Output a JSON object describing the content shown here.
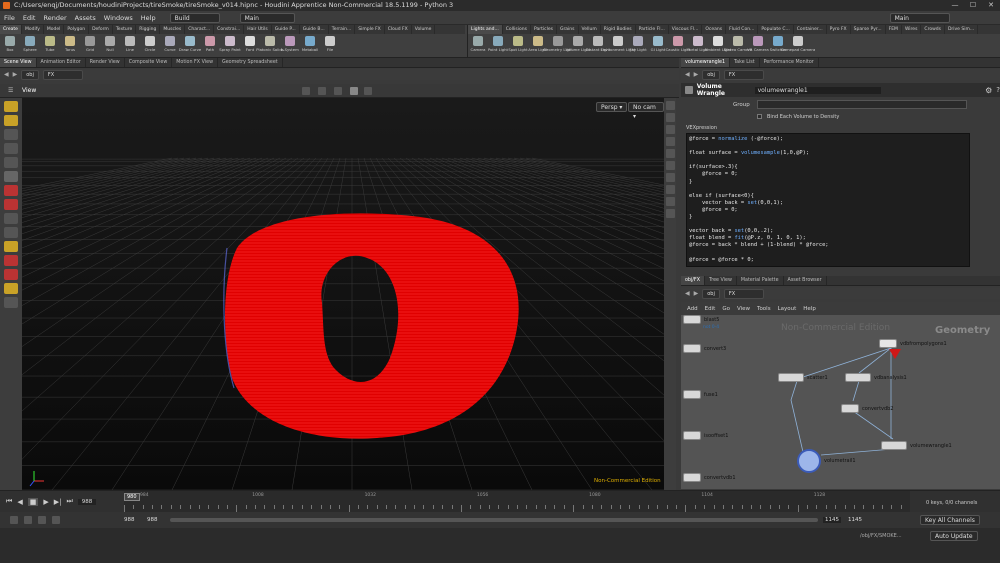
{
  "window": {
    "title": "C:/Users/enqj/Documents/houdiniProjects/tireSmoke/tireSmoke_v014.hipnc - Houdini Apprentice Non-Commercial 18.5.1199 - Python 3"
  },
  "menu": {
    "items": [
      "File",
      "Edit",
      "Render",
      "Assets",
      "Windows",
      "Help"
    ],
    "desktop_left": "Build",
    "desktop_mid": "Main",
    "desktop_right": "Main"
  },
  "shelf_left": {
    "tabs": [
      "Create",
      "Modify",
      "Model",
      "Polygon",
      "Deform",
      "Texture",
      "Rigging",
      "Muscles",
      "Charact...",
      "Constrai...",
      "Hair Utils",
      "Guide P...",
      "Guide B...",
      "Terrain...",
      "Simple FX",
      "Cloud FX",
      "Volume"
    ],
    "tools": [
      "Box",
      "Sphere",
      "Tube",
      "Torus",
      "Grid",
      "Null",
      "Line",
      "Circle",
      "Curve",
      "Draw Curve",
      "Path",
      "Spray Paint",
      "Font",
      "Platonic Solids",
      "L-System",
      "Metaball",
      "File"
    ]
  },
  "shelf_right": {
    "tabs": [
      "Lights and...",
      "Collisions",
      "Particles",
      "Grains",
      "Vellum",
      "Rigid Bodies",
      "Particle Fl...",
      "Viscous Fl...",
      "Oceans",
      "Fluid Con...",
      "Populate C...",
      "Container...",
      "Pyro FX",
      "Sparse Pyr...",
      "FEM",
      "Wires",
      "Crowds",
      "Drive Sim..."
    ],
    "tools": [
      "Camera",
      "Point Light",
      "Spot Light",
      "Area Light",
      "Geometry Light",
      "Volume Light",
      "Distant Light",
      "Environment Light",
      "Sky Light",
      "GI Light",
      "Caustic Light",
      "Portal Light",
      "Ambient Light",
      "Stereo Camera",
      "VR Camera",
      "Switcher",
      "Gamepad Camera"
    ]
  },
  "viewer_tabs": [
    "Scene View",
    "Animation Editor",
    "Render View",
    "Composite View",
    "Motion FX View",
    "Geometry Spreadsheet"
  ],
  "viewer": {
    "path_root": "obj",
    "path_node": "FX",
    "label": "View",
    "persp": "Persp",
    "cam": "No cam",
    "watermark": "Non-Commercial Edition"
  },
  "param_tabs": [
    "volumewrangle1",
    "Take List",
    "Performance Monitor"
  ],
  "params": {
    "path_root": "obj",
    "path_node": "FX",
    "node_type": "Volume Wrangle",
    "node_name": "volumewrangle1",
    "group_label": "Group",
    "bind_label": "Bind Each Volume to Density",
    "vex_label": "VEXpression",
    "code": [
      "@force = normalize (-@force);",
      "",
      "float surface = volumesample(1,0,@P);",
      "",
      "if(surface>.3){",
      "    @force = 0;",
      "}",
      "",
      "else if (surface<0){",
      "    vector back = set(0,0,1);",
      "    @force = 0;",
      "}",
      "",
      "vector back = set(0,0,.2);",
      "float blend = fit(@P.z, 0, 1, 0, 1);",
      "@force = back * blend + (1-blend) * @force;",
      "",
      "@force = @force * 0;"
    ]
  },
  "net_tabs": [
    "obj/FX",
    "Tree View",
    "Material Palette",
    "Asset Browser"
  ],
  "network": {
    "path_root": "obj",
    "path_node": "FX",
    "menu": [
      "Add",
      "Edit",
      "Go",
      "View",
      "Tools",
      "Layout",
      "Help"
    ],
    "watermark": "Non-Commercial Edition",
    "context": "Geometry",
    "nodes": {
      "blast": "blast5",
      "blast_sub": "not 0-4",
      "convert": "convert3",
      "fuse": "fuse1",
      "isooffset": "isooffset1",
      "convertvdb": "convertvdb1",
      "vdbfrompolygons": "vdbfrompolygons1",
      "scatter": "scatter1",
      "vdbanalysis": "vdbanalysis1",
      "convertvdb2": "convertvdb2",
      "volumewrangle": "volumewrangle1",
      "volumetrail": "volumetrail1"
    }
  },
  "timeline": {
    "current_frame": "988",
    "ticks": [
      "984",
      "1008",
      "1032",
      "1056",
      "1080",
      "1104",
      "1128"
    ],
    "playhead": "980",
    "range_start": "988",
    "range_start2": "988",
    "range_end": "1145",
    "range_end2": "1145",
    "keys_info": "0 keys, 0/0 channels",
    "key_all": "Key All Channels"
  },
  "status": {
    "path": "/obj/FX/SMOKE...",
    "auto_update": "Auto Update"
  },
  "colors": {
    "accent_red": "#ff1a1a",
    "node_bg": "#545454",
    "code_bg": "#1e1e1e"
  }
}
